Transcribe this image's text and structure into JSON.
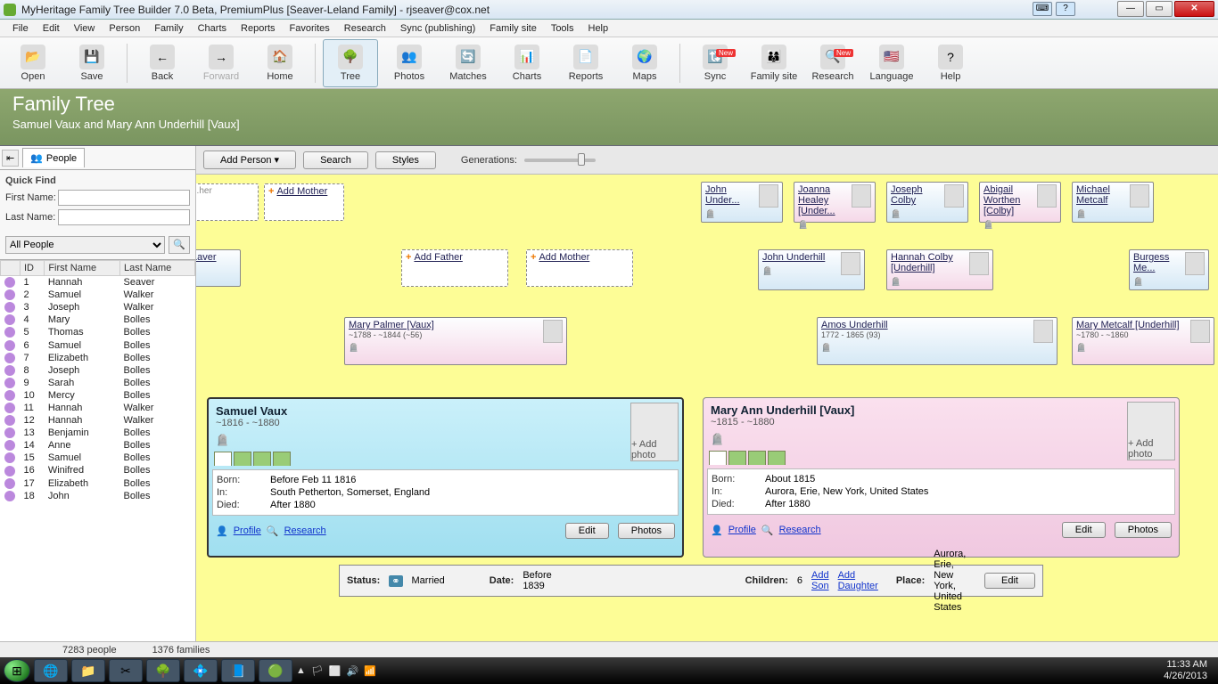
{
  "window": {
    "title": "MyHeritage Family Tree Builder 7.0 Beta, PremiumPlus [Seaver-Leland Family] - rjseaver@cox.net"
  },
  "menu": [
    "File",
    "Edit",
    "View",
    "Person",
    "Family",
    "Charts",
    "Reports",
    "Favorites",
    "Research",
    "Sync (publishing)",
    "Family site",
    "Tools",
    "Help"
  ],
  "toolbar": [
    {
      "label": "Open",
      "icon": "📂"
    },
    {
      "label": "Save",
      "icon": "💾"
    },
    {
      "label": "Back",
      "icon": "←"
    },
    {
      "label": "Forward",
      "icon": "→",
      "disabled": true
    },
    {
      "label": "Home",
      "icon": "🏠"
    },
    {
      "label": "Tree",
      "icon": "🌳",
      "active": true
    },
    {
      "label": "Photos",
      "icon": "👥"
    },
    {
      "label": "Matches",
      "icon": "🔄"
    },
    {
      "label": "Charts",
      "icon": "📊"
    },
    {
      "label": "Reports",
      "icon": "📄"
    },
    {
      "label": "Maps",
      "icon": "🌍"
    },
    {
      "label": "Sync",
      "icon": "🔃",
      "badge": "New"
    },
    {
      "label": "Family site",
      "icon": "👨‍👩‍👦"
    },
    {
      "label": "Research",
      "icon": "🔍",
      "badge": "New"
    },
    {
      "label": "Language",
      "icon": "🇺🇸"
    },
    {
      "label": "Help",
      "icon": "?"
    }
  ],
  "banner": {
    "title": "Family Tree",
    "subtitle": "Samuel Vaux and Mary Ann Underhill [Vaux]"
  },
  "sidebar": {
    "tab": "People",
    "quickfind": "Quick Find",
    "firstname_lbl": "First Name:",
    "lastname_lbl": "Last Name:",
    "filter": "All People",
    "columns": [
      "ID",
      "First Name",
      "Last Name"
    ],
    "people": [
      {
        "id": "1",
        "first": "Hannah",
        "last": "Seaver"
      },
      {
        "id": "2",
        "first": "Samuel",
        "last": "Walker"
      },
      {
        "id": "3",
        "first": "Joseph",
        "last": "Walker"
      },
      {
        "id": "4",
        "first": "Mary",
        "last": "Bolles"
      },
      {
        "id": "5",
        "first": "Thomas",
        "last": "Bolles"
      },
      {
        "id": "6",
        "first": "Samuel",
        "last": "Bolles"
      },
      {
        "id": "7",
        "first": "Elizabeth",
        "last": "Bolles"
      },
      {
        "id": "8",
        "first": "Joseph",
        "last": "Bolles"
      },
      {
        "id": "9",
        "first": "Sarah",
        "last": "Bolles"
      },
      {
        "id": "10",
        "first": "Mercy",
        "last": "Bolles"
      },
      {
        "id": "11",
        "first": "Hannah",
        "last": "Walker"
      },
      {
        "id": "12",
        "first": "Hannah",
        "last": "Walker"
      },
      {
        "id": "13",
        "first": "Benjamin",
        "last": "Bolles"
      },
      {
        "id": "14",
        "first": "Anne",
        "last": "Bolles"
      },
      {
        "id": "15",
        "first": "Samuel",
        "last": "Bolles"
      },
      {
        "id": "16",
        "first": "Winifred",
        "last": "Bolles"
      },
      {
        "id": "17",
        "first": "Elizabeth",
        "last": "Bolles"
      },
      {
        "id": "18",
        "first": "John",
        "last": "Bolles"
      }
    ]
  },
  "treebar": {
    "add": "Add Person",
    "search": "Search",
    "styles": "Styles",
    "generations": "Generations:"
  },
  "ancestors": {
    "top": [
      {
        "name": "John Under...",
        "g": "m"
      },
      {
        "name": "Joanna Healey [Under...",
        "g": "f"
      },
      {
        "name": "Joseph Colby",
        "g": "m"
      },
      {
        "name": "Abigail Worthen [Colby]",
        "g": "f"
      },
      {
        "name": "Michael Metcalf",
        "g": "m"
      }
    ],
    "mid": [
      {
        "name": "John Underhill",
        "g": "m"
      },
      {
        "name": "Hannah Colby [Underhill]",
        "g": "f"
      },
      {
        "name": "Burgess Me...",
        "g": "m"
      }
    ],
    "par": [
      {
        "name": "Mary Palmer [Vaux]",
        "dates": "~1788 - ~1844 (~56)",
        "g": "f"
      },
      {
        "name": "Amos Underhill",
        "dates": "1772 - 1865 (93)",
        "g": "m"
      },
      {
        "name": "Mary Metcalf [Underhill]",
        "dates": "~1780 - ~1860",
        "g": "f"
      }
    ],
    "add_mother": "Add Mother",
    "add_father": "Add Father",
    "laver": "Laver"
  },
  "focus": {
    "p1": {
      "name": "Samuel Vaux",
      "dates": "~1816 - ~1880",
      "born_l": "Born:",
      "born": "Before Feb 11 1816",
      "in_l": "In:",
      "in": "South Petherton, Somerset, England",
      "died_l": "Died:",
      "died": "After 1880",
      "addphoto": "+ Add photo"
    },
    "p2": {
      "name": "Mary Ann Underhill [Vaux]",
      "dates": "~1815 - ~1880",
      "born_l": "Born:",
      "born": "About 1815",
      "in_l": "In:",
      "in": "Aurora, Erie, New York, United States",
      "died_l": "Died:",
      "died": "After 1880",
      "addphoto": "+ Add photo"
    },
    "profile": "Profile",
    "research": "Research",
    "edit": "Edit",
    "photos": "Photos"
  },
  "family": {
    "status_l": "Status:",
    "status": "Married",
    "date_l": "Date:",
    "date": "Before 1839",
    "children_l": "Children:",
    "children": "6",
    "addson": "Add Son",
    "adddau": "Add Daughter",
    "place_l": "Place:",
    "place": "Aurora, Erie, New York, United States",
    "edit": "Edit"
  },
  "status": {
    "people": "7283 people",
    "families": "1376 families"
  },
  "taskbar": {
    "time": "11:33 AM",
    "date": "4/26/2013"
  }
}
